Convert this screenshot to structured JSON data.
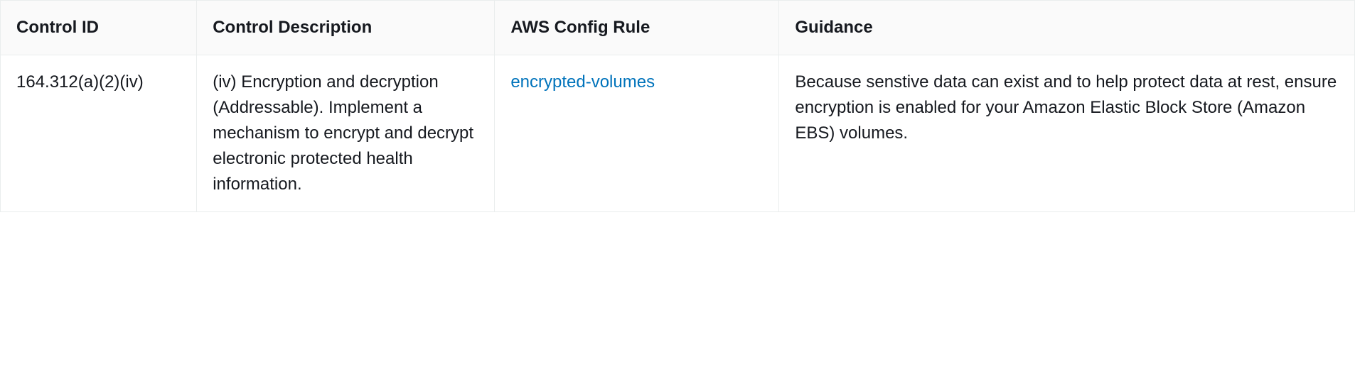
{
  "table": {
    "headers": {
      "control_id": "Control ID",
      "control_description": "Control Description",
      "aws_config_rule": "AWS Config Rule",
      "guidance": "Guidance"
    },
    "rows": [
      {
        "control_id": "164.312(a)(2)(iv)",
        "control_description": "(iv) Encryption and decryption (Addressable). Implement a mechanism to encrypt and decrypt electronic protected health information.",
        "aws_config_rule": "encrypted-volumes",
        "guidance": "Because senstive data can exist and to help protect data at rest, ensure encryption is enabled for your Amazon Elastic Block Store (Amazon EBS) volumes."
      }
    ]
  }
}
